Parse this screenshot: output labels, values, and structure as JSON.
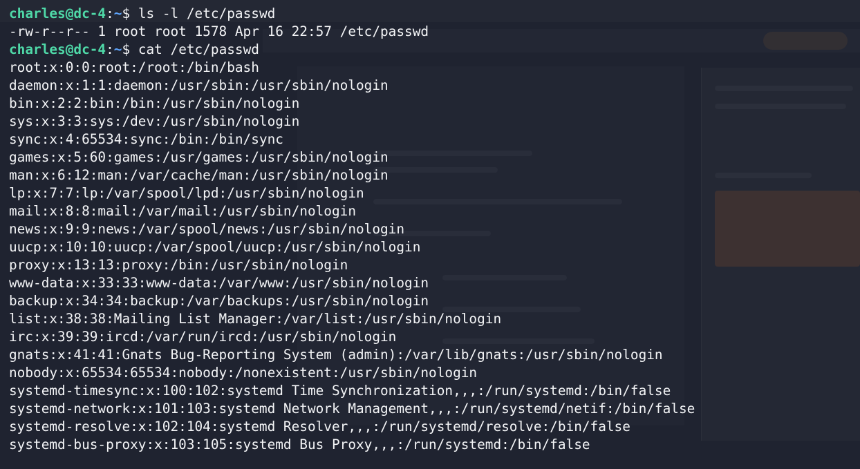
{
  "terminal": {
    "user_host": "charles@dc-4",
    "path": "~",
    "prompt_symbol": "$",
    "commands": [
      {
        "command": "ls -l /etc/passwd",
        "output": [
          "-rw-r--r-- 1 root root 1578 Apr 16 22:57 /etc/passwd"
        ]
      },
      {
        "command": "cat /etc/passwd",
        "output": [
          "root:x:0:0:root:/root:/bin/bash",
          "daemon:x:1:1:daemon:/usr/sbin:/usr/sbin/nologin",
          "bin:x:2:2:bin:/bin:/usr/sbin/nologin",
          "sys:x:3:3:sys:/dev:/usr/sbin/nologin",
          "sync:x:4:65534:sync:/bin:/bin/sync",
          "games:x:5:60:games:/usr/games:/usr/sbin/nologin",
          "man:x:6:12:man:/var/cache/man:/usr/sbin/nologin",
          "lp:x:7:7:lp:/var/spool/lpd:/usr/sbin/nologin",
          "mail:x:8:8:mail:/var/mail:/usr/sbin/nologin",
          "news:x:9:9:news:/var/spool/news:/usr/sbin/nologin",
          "uucp:x:10:10:uucp:/var/spool/uucp:/usr/sbin/nologin",
          "proxy:x:13:13:proxy:/bin:/usr/sbin/nologin",
          "www-data:x:33:33:www-data:/var/www:/usr/sbin/nologin",
          "backup:x:34:34:backup:/var/backups:/usr/sbin/nologin",
          "list:x:38:38:Mailing List Manager:/var/list:/usr/sbin/nologin",
          "irc:x:39:39:ircd:/var/run/ircd:/usr/sbin/nologin",
          "gnats:x:41:41:Gnats Bug-Reporting System (admin):/var/lib/gnats:/usr/sbin/nologin",
          "nobody:x:65534:65534:nobody:/nonexistent:/usr/sbin/nologin",
          "systemd-timesync:x:100:102:systemd Time Synchronization,,,:/run/systemd:/bin/false",
          "systemd-network:x:101:103:systemd Network Management,,,:/run/systemd/netif:/bin/false",
          "systemd-resolve:x:102:104:systemd Resolver,,,:/run/systemd/resolve:/bin/false",
          "systemd-bus-proxy:x:103:105:systemd Bus Proxy,,,:/run/systemd:/bin/false"
        ]
      }
    ]
  },
  "colors": {
    "background": "#1f2330",
    "prompt_user": "#4fd9a8",
    "prompt_path": "#5fa6ff",
    "text": "#f3f4f6"
  }
}
